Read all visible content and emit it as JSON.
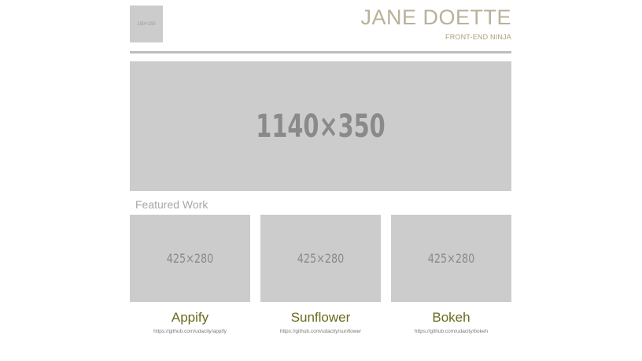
{
  "header": {
    "logo_label": "150×150",
    "name": "JANE DOETTE",
    "subtitle": "FRONT-END NINJA"
  },
  "hero": {
    "label": "1140×350"
  },
  "featured": {
    "title": "Featured Work",
    "projects": [
      {
        "thumb_label": "425×280",
        "title": "Appify",
        "link": "https://github.com/udacity/appify"
      },
      {
        "thumb_label": "425×280",
        "title": "Sunflower",
        "link": "https://github.com/udacity/sunflower"
      },
      {
        "thumb_label": "425×280",
        "title": "Bokeh",
        "link": "https://github.com/udacity/bokeh"
      }
    ]
  },
  "colors": {
    "placeholder_bg": "#cccccc",
    "placeholder_text": "#8a8a8a",
    "name_color": "#b8b19a",
    "project_title": "#6b6b1e",
    "rule": "#bdbdbd"
  }
}
